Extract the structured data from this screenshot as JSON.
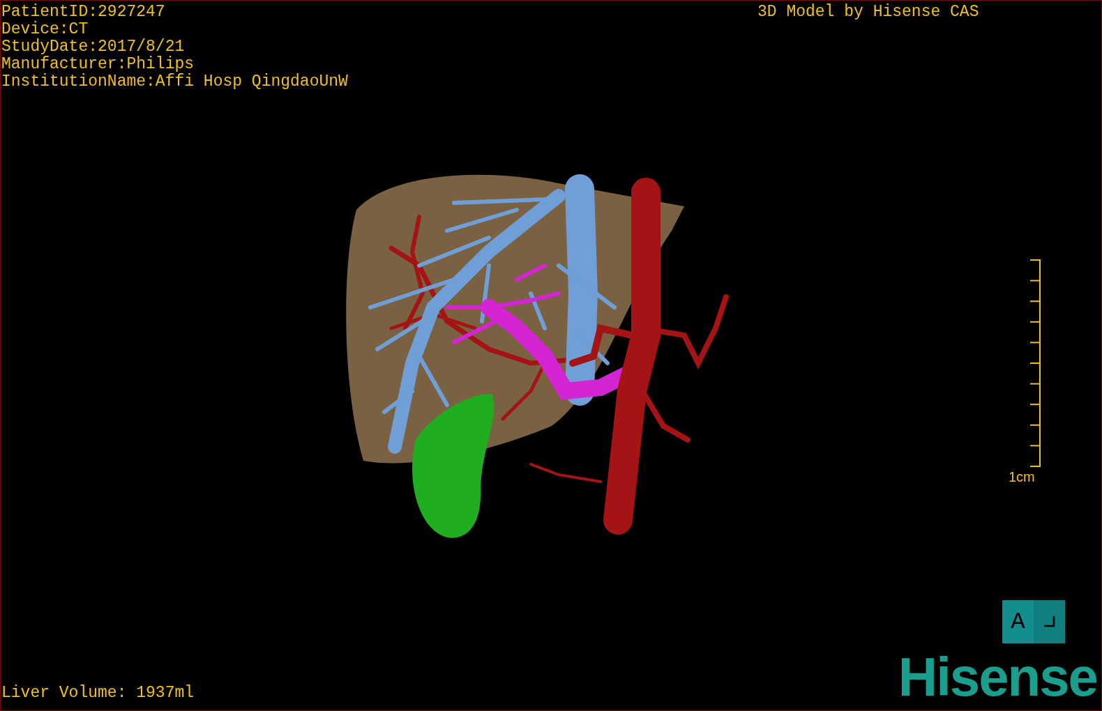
{
  "patient_info": [
    "PatientID:2927247",
    "Device:CT",
    "StudyDate:2017/8/21",
    "Manufacturer:Philips",
    "InstitutionName:Affi Hosp QingdaoUnW"
  ],
  "title": "3D Model by Hisense CAS",
  "scale_bar": {
    "label": "1cm"
  },
  "orientation_cube": {
    "label": "A"
  },
  "liver_volume": "Liver Volume: 1937ml",
  "logo": "Hisense"
}
